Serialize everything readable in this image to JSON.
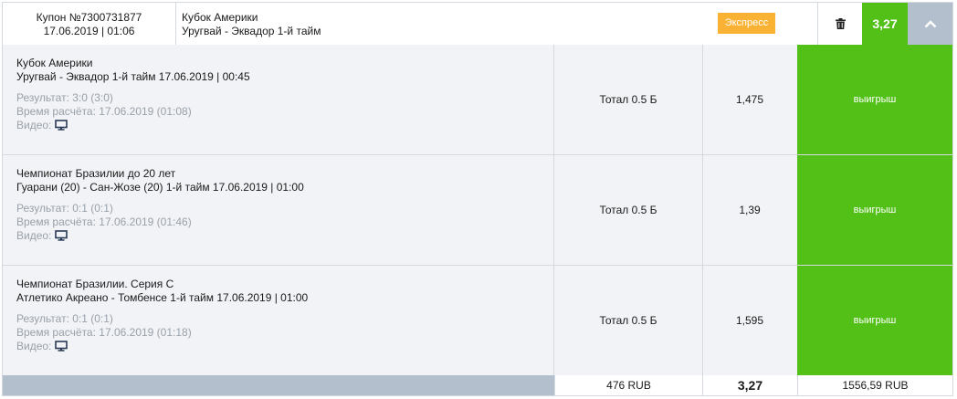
{
  "header": {
    "coupon_label": "Купон №7300731877",
    "coupon_date": "17.06.2019 | 01:06",
    "tournament": "Кубок Америки",
    "match": "Уругвай - Эквадор 1-й тайм",
    "badge": "Экспресс",
    "odds": "3,27",
    "trash_icon": "trash-icon",
    "toggle_icon": "chevron-up-icon"
  },
  "events": [
    {
      "tournament": "Кубок Америки",
      "match": "Уругвай - Эквадор 1-й тайм 17.06.2019 | 00:45",
      "result": "Результат: 3:0 (3:0)",
      "settle_time": "Время расчёта: 17.06.2019 (01:08)",
      "video_label": "Видео:",
      "market": "Тотал 0.5 Б",
      "coef": "1,475",
      "status": "выигрыш"
    },
    {
      "tournament": "Чемпионат Бразилии до 20 лет",
      "match": "Гуарани (20) - Сан-Жозе (20) 1-й тайм 17.06.2019 | 01:00",
      "result": "Результат: 0:1 (0:1)",
      "settle_time": "Время расчёта: 17.06.2019 (01:46)",
      "video_label": "Видео:",
      "market": "Тотал 0.5 Б",
      "coef": "1,39",
      "status": "выигрыш"
    },
    {
      "tournament": "Чемпионат Бразилии. Серия С",
      "match": "Атлетико Акреано - Томбенсе 1-й тайм 17.06.2019 | 01:00",
      "result": "Результат: 0:1 (0:1)",
      "settle_time": "Время расчёта: 17.06.2019 (01:18)",
      "video_label": "Видео:",
      "market": "Тотал 0.5 Б",
      "coef": "1,595",
      "status": "выигрыш"
    }
  ],
  "footer": {
    "stake": "476 RUB",
    "total_odds": "3,27",
    "win_amount": "1556,59 RUB"
  },
  "colors": {
    "win_green": "#52c016",
    "express_orange": "#f9b233",
    "header_gray": "#b3bfcc"
  }
}
